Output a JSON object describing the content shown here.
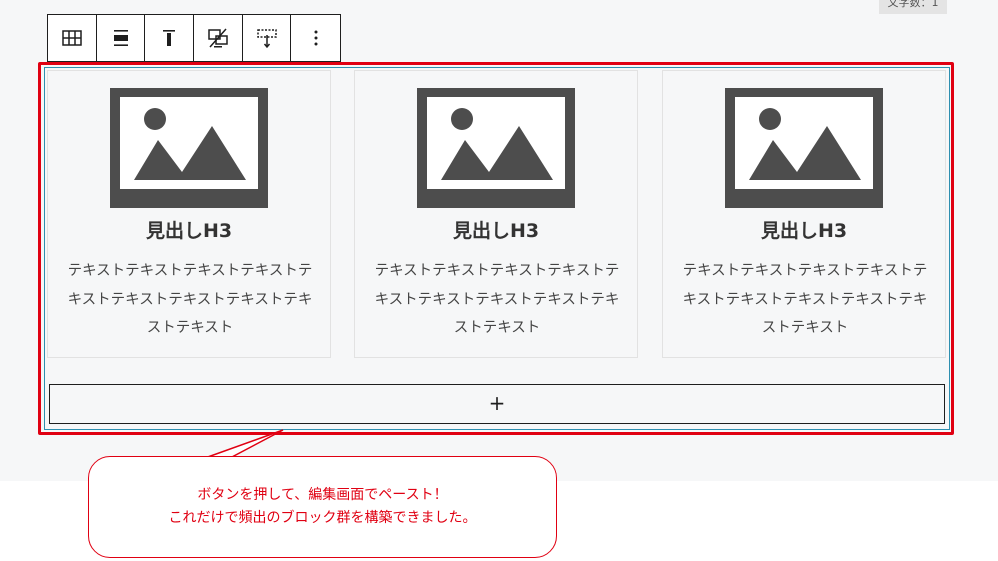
{
  "editor": {
    "char_count": "文字数：1",
    "toolbar": {
      "buttons": [
        {
          "name": "block-type-icon"
        },
        {
          "name": "align-icon"
        },
        {
          "name": "vertical-align-top-icon"
        },
        {
          "name": "stack-on-mobile-icon"
        },
        {
          "name": "min-height-icon"
        },
        {
          "name": "more-options-icon"
        }
      ]
    },
    "cards": [
      {
        "heading": "見出しH3",
        "text": "テキストテキストテキストテキストテキストテキストテキストテキストテキストテキスト"
      },
      {
        "heading": "見出しH3",
        "text": "テキストテキストテキストテキストテキストテキストテキストテキストテキストテキスト"
      },
      {
        "heading": "見出しH3",
        "text": "テキストテキストテキストテキストテキストテキストテキストテキストテキストテキスト"
      }
    ],
    "add_block_label": "+"
  },
  "annotation": {
    "line1": "ボタンを押して、編集画面でペースト！",
    "line2": "これだけで頻出のブロック群を構築できました。",
    "color": "#e00012"
  }
}
